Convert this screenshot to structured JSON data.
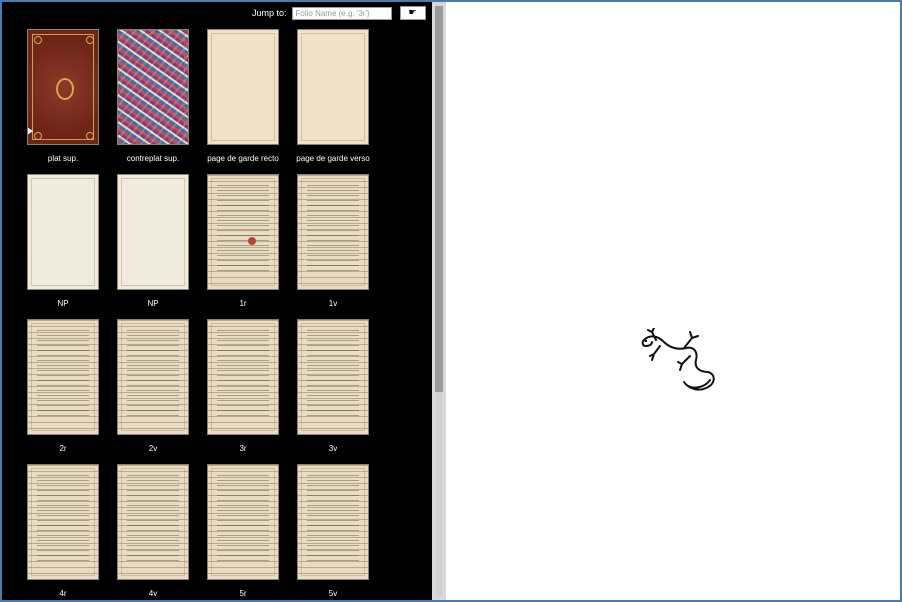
{
  "jump": {
    "label": "Jump to:",
    "placeholder": "Folio Name (e.g. '3r')",
    "button_icon": "pointing-hand-icon",
    "button_glyph": "☛"
  },
  "folios": [
    {
      "label": "plat sup.",
      "kind": "cover"
    },
    {
      "label": "contreplat sup.",
      "kind": "marble"
    },
    {
      "label": "page de garde recto",
      "kind": "blank-warm"
    },
    {
      "label": "page de garde verso",
      "kind": "blank-warm"
    },
    {
      "label": "NP",
      "kind": "blank"
    },
    {
      "label": "NP",
      "kind": "blank"
    },
    {
      "label": "1r",
      "kind": "written-seal"
    },
    {
      "label": "1v",
      "kind": "written"
    },
    {
      "label": "2r",
      "kind": "written"
    },
    {
      "label": "2v",
      "kind": "written"
    },
    {
      "label": "3r",
      "kind": "written"
    },
    {
      "label": "3v",
      "kind": "written"
    },
    {
      "label": "4r",
      "kind": "written"
    },
    {
      "label": "4v",
      "kind": "written"
    },
    {
      "label": "5r",
      "kind": "written"
    },
    {
      "label": "5v",
      "kind": "written"
    }
  ],
  "viewer": {
    "loading_icon": "salamander-icon"
  }
}
